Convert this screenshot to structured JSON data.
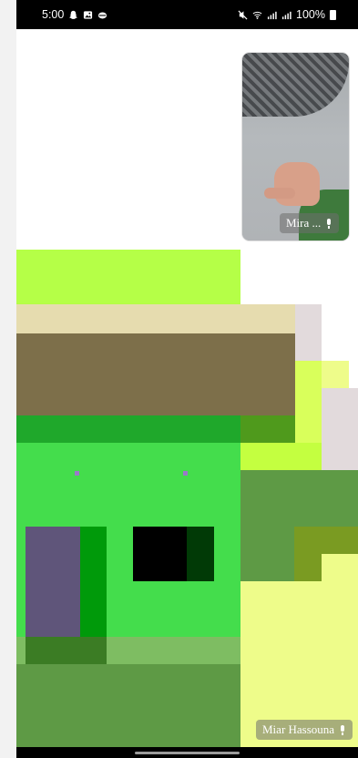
{
  "status_bar": {
    "time": "5:00",
    "battery": "100%",
    "left_icons": [
      "snapchat-icon",
      "gallery-icon",
      "cloud-icon"
    ],
    "right_icons": [
      "mute-icon",
      "wifi-icon",
      "signal-icon",
      "signal-icon",
      "battery-icon"
    ]
  },
  "call": {
    "self_name": "Mira ...",
    "remote_name": "Miar Hassouna"
  },
  "colors": {
    "lime": "#b5ff47",
    "green": "#44dd4c",
    "dark_green": "#1fa82b",
    "olive": "#7d6f4a",
    "beige": "#e6dcaf",
    "pale_yellow": "#eefc8a",
    "moss": "#5e9a45",
    "purple": "#5f557a"
  }
}
